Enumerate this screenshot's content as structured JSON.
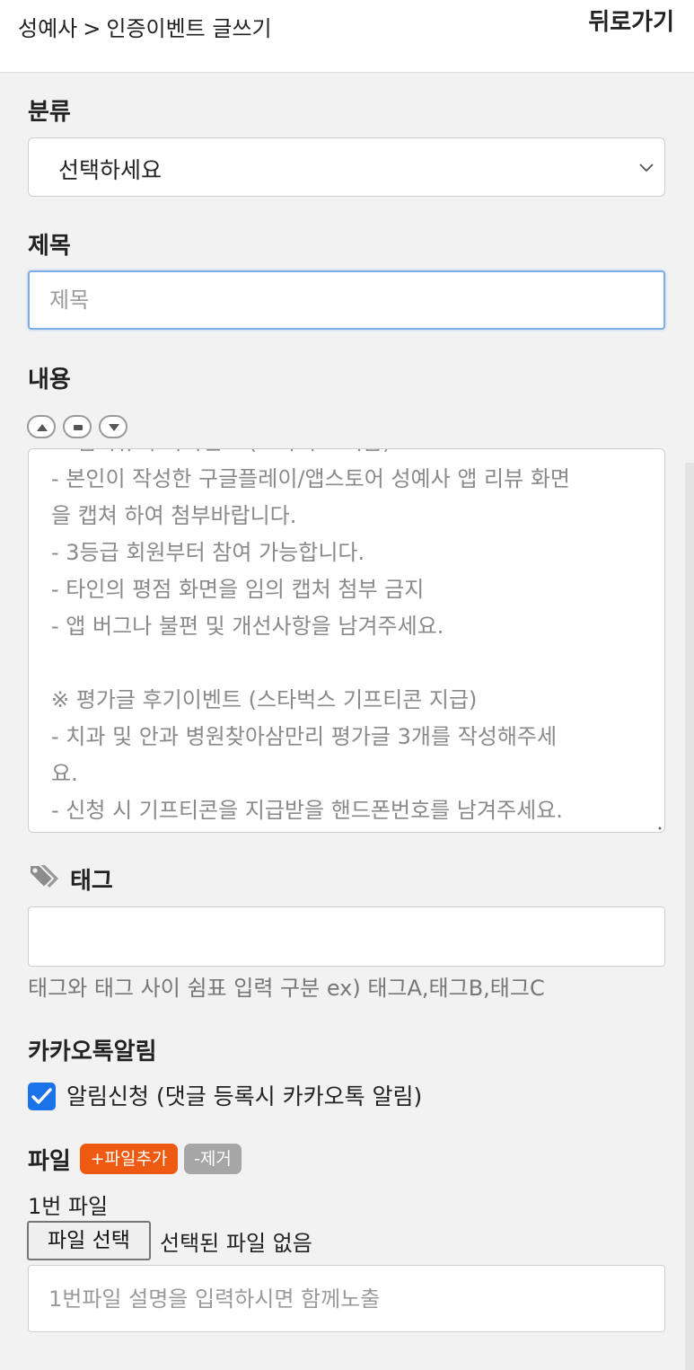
{
  "header": {
    "breadcrumb_root": "성예사",
    "breadcrumb_sep": ">",
    "breadcrumb_current": "인증이벤트 글쓰기",
    "back_label": "뒤로가기"
  },
  "category": {
    "label": "분류",
    "selected": "선택하세요"
  },
  "title_field": {
    "label": "제목",
    "placeholder": "제목",
    "value": ""
  },
  "content": {
    "label": "내용",
    "lines": [
      "※ 앱리뷰 후기이벤트 (스타벅스 지급)",
      "- 본인이 작성한 구글플레이/앱스토어 성예사 앱 리뷰 화면",
      "을 캡쳐 하여 첨부바랍니다.",
      "- 3등급 회원부터 참여 가능합니다.",
      "- 타인의 평점 화면을 임의 캡처 첨부 금지",
      "- 앱 버그나 불편 및 개선사항을 남겨주세요.",
      "",
      "※ 평가글 후기이벤트 (스타벅스 기프티콘 지급)",
      "- 치과 및 안과 병원찾아삼만리 평가글 3개를 작성해주세",
      "요.",
      "- 신청 시 기프티콘을 지급받을 핸드폰번호를 남겨주세요."
    ]
  },
  "tags": {
    "label": "태그",
    "value": "",
    "help": "태그와 태그 사이 쉼표 입력 구분 ex) 태그A,태그B,태그C"
  },
  "kakao": {
    "label": "카카오톡알림",
    "checkbox_label": "알림신청 (댓글 등록시 카카오톡 알림)",
    "checked": true
  },
  "files": {
    "label": "파일",
    "add_label": "+파일추가",
    "remove_label": "-제거",
    "item_label": "1번 파일",
    "choose_label": "파일 선택",
    "status": "선택된 파일 없음",
    "desc_placeholder": "1번파일 설명을 입력하시면 함께노출"
  },
  "colors": {
    "accent": "#1a73e8",
    "add_badge": "#ef5a12",
    "remove_badge": "#a6a6a6",
    "focus_border": "#7eaee6"
  }
}
